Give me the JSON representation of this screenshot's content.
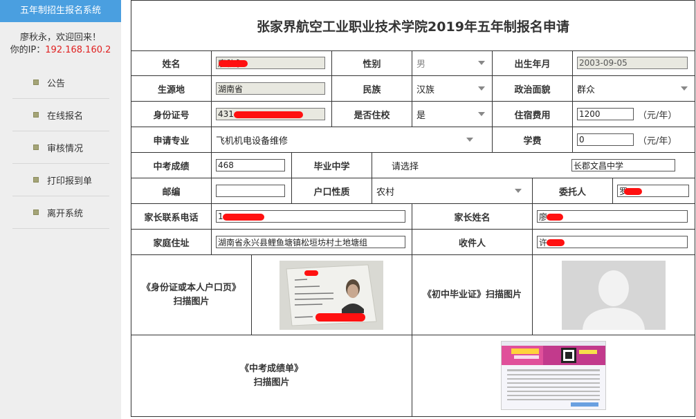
{
  "sidebar": {
    "title": "五年制招生报名系统",
    "welcome": "廖秋永，欢迎回来！",
    "ip_label": "你的IP：",
    "ip_value": "192.168.160.2",
    "menu": [
      {
        "label": "公告"
      },
      {
        "label": "在线报名"
      },
      {
        "label": "审核情况"
      },
      {
        "label": "打印报到单"
      },
      {
        "label": "离开系统"
      }
    ]
  },
  "form": {
    "title": "张家界航空工业职业技术学院2019年五年制报名申请",
    "name": {
      "label": "姓名",
      "value": "廖秋永"
    },
    "gender": {
      "label": "性别",
      "value": "男"
    },
    "birth": {
      "label": "出生年月",
      "value": "2003-09-05"
    },
    "origin": {
      "label": "生源地",
      "value": "湖南省"
    },
    "ethnicity": {
      "label": "民族",
      "value": "汉族"
    },
    "political": {
      "label": "政治面貌",
      "value": "群众"
    },
    "id_number": {
      "label": "身份证号",
      "value": "431"
    },
    "boarding": {
      "label": "是否住校",
      "value": "是"
    },
    "lodging_fee": {
      "label": "住宿费用",
      "value": "1200",
      "unit": "（元/年）"
    },
    "major": {
      "label": "申请专业",
      "value": "飞机机电设备维修"
    },
    "tuition": {
      "label": "学费",
      "value": "0",
      "unit": "（元/年）"
    },
    "exam_score": {
      "label": "中考成绩",
      "value": "468"
    },
    "graduated_school": {
      "label": "毕业中学",
      "select_placeholder": "请选择",
      "value": "长郡文昌中学"
    },
    "postcode": {
      "label": "邮编",
      "value": ""
    },
    "hukou": {
      "label": "户口性质",
      "value": "农村"
    },
    "entrusted": {
      "label": "委托人",
      "value": "罗"
    },
    "parent_phone": {
      "label": "家长联系电话",
      "value": "1"
    },
    "parent_name": {
      "label": "家长姓名",
      "value": "廖"
    },
    "address": {
      "label": "家庭住址",
      "value": "湖南省永兴县鲤鱼塘镇松垣坊村土地塘组"
    },
    "recipient": {
      "label": "收件人",
      "value": "许"
    },
    "id_scan": {
      "caption_1": "《身份证或本人户口页》",
      "caption_2": "扫描图片"
    },
    "diploma_scan": {
      "caption_1": "《初中毕业证》扫描图片"
    },
    "score_scan": {
      "caption_1": "《中考成绩单》",
      "caption_2": "扫描图片"
    }
  },
  "colors": {
    "sidebar_title_bg": "#4a9fe0",
    "ip_red": "#e02020",
    "redaction": "#ff1010"
  }
}
